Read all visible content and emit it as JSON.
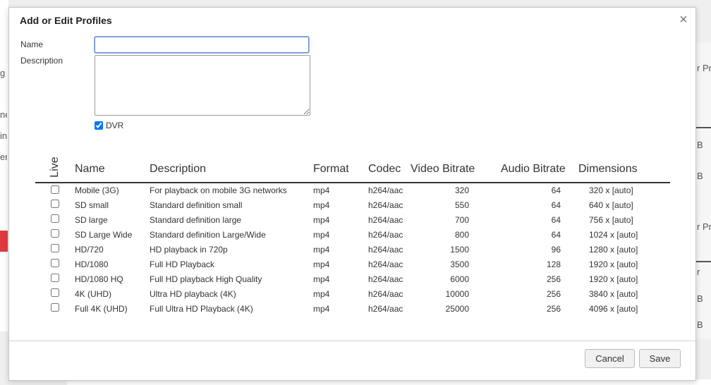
{
  "modal": {
    "title": "Add or Edit Profiles",
    "close_glyph": "×"
  },
  "form": {
    "name_label": "Name",
    "name_value": "",
    "description_label": "Description",
    "description_value": "",
    "dvr_label": "DVR",
    "dvr_checked": true
  },
  "table": {
    "columns": {
      "live": "Live",
      "name": "Name",
      "description": "Description",
      "format": "Format",
      "codec": "Codec",
      "video_bitrate": "Video Bitrate",
      "audio_bitrate": "Audio Bitrate",
      "dimensions": "Dimensions"
    },
    "rows": [
      {
        "live": false,
        "name": "Mobile (3G)",
        "description": "For playback on mobile 3G networks",
        "format": "mp4",
        "codec": "h264/aac",
        "video_bitrate": "320",
        "audio_bitrate": "64",
        "dimensions": "320 x [auto]"
      },
      {
        "live": false,
        "name": "SD small",
        "description": "Standard definition small",
        "format": "mp4",
        "codec": "h264/aac",
        "video_bitrate": "550",
        "audio_bitrate": "64",
        "dimensions": "640 x [auto]"
      },
      {
        "live": false,
        "name": "SD large",
        "description": "Standard definition large",
        "format": "mp4",
        "codec": "h264/aac",
        "video_bitrate": "700",
        "audio_bitrate": "64",
        "dimensions": "756 x [auto]"
      },
      {
        "live": false,
        "name": "SD Large Wide",
        "description": "Standard definition Large/Wide",
        "format": "mp4",
        "codec": "h264/aac",
        "video_bitrate": "800",
        "audio_bitrate": "64",
        "dimensions": "1024 x [auto]"
      },
      {
        "live": false,
        "name": "HD/720",
        "description": "HD playback in 720p",
        "format": "mp4",
        "codec": "h264/aac",
        "video_bitrate": "1500",
        "audio_bitrate": "96",
        "dimensions": "1280 x [auto]"
      },
      {
        "live": false,
        "name": "HD/1080",
        "description": "Full HD Playback",
        "format": "mp4",
        "codec": "h264/aac",
        "video_bitrate": "3500",
        "audio_bitrate": "128",
        "dimensions": "1920 x [auto]"
      },
      {
        "live": false,
        "name": "HD/1080 HQ",
        "description": "Full HD playback High Quality",
        "format": "mp4",
        "codec": "h264/aac",
        "video_bitrate": "6000",
        "audio_bitrate": "256",
        "dimensions": "1920 x [auto]"
      },
      {
        "live": false,
        "name": "4K (UHD)",
        "description": "Ultra HD playback (4K)",
        "format": "mp4",
        "codec": "h264/aac",
        "video_bitrate": "10000",
        "audio_bitrate": "256",
        "dimensions": "3840 x [auto]"
      },
      {
        "live": false,
        "name": "Full 4K (UHD)",
        "description": "Full Ultra HD Playback (4K)",
        "format": "mp4",
        "codec": "h264/aac",
        "video_bitrate": "25000",
        "audio_bitrate": "256",
        "dimensions": "4096 x [auto]"
      }
    ]
  },
  "footer": {
    "cancel_label": "Cancel",
    "save_label": "Save"
  },
  "background": {
    "fragments": [
      "g",
      "ne",
      "in",
      "er",
      "r Pr",
      "B",
      "B",
      "r Pr",
      "r",
      "B",
      "B"
    ]
  },
  "colors": {
    "accent_red": "#e03a3e",
    "input_focus_border": "#6b8fce"
  }
}
